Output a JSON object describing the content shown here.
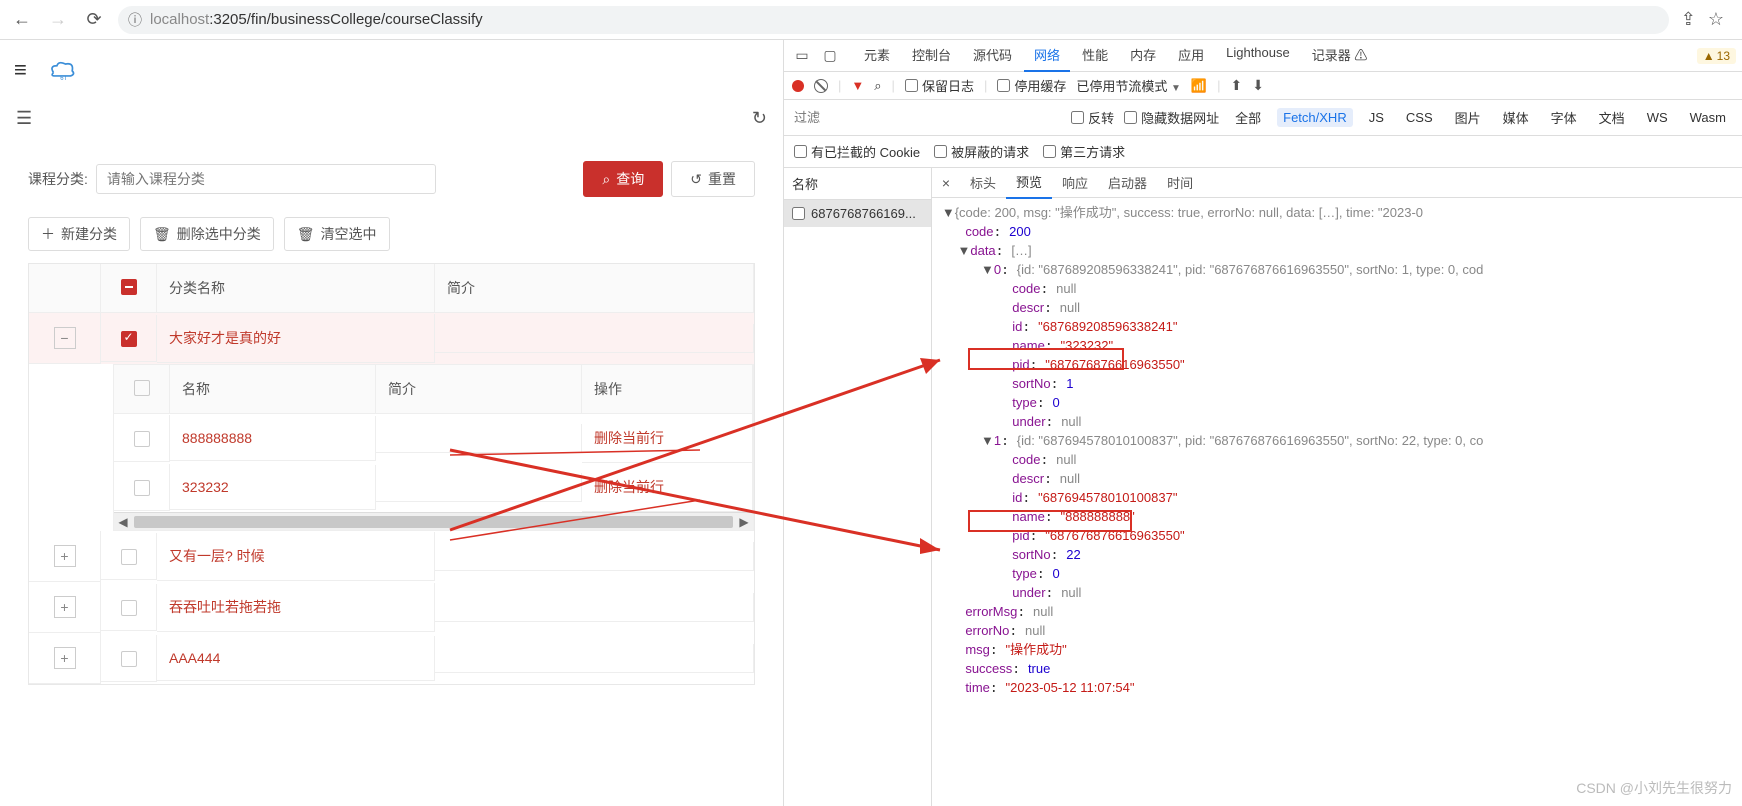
{
  "browser": {
    "url_host": "localhost",
    "url_rest": ":3205/fin/businessCollege/courseClassify"
  },
  "toolbar": {
    "filter_label": "课程分类:",
    "filter_placeholder": "请输入课程分类",
    "query_btn": "查询",
    "reset_btn": "重置",
    "new_btn": "新建分类",
    "del_sel_btn": "删除选中分类",
    "clear_sel_btn": "清空选中"
  },
  "table": {
    "headers": {
      "name": "分类名称",
      "desc": "简介"
    },
    "inner_headers": {
      "name": "名称",
      "desc": "简介",
      "action": "操作"
    },
    "row0": {
      "name": "大家好才是真的好"
    },
    "inner": [
      {
        "name": "888888888",
        "action": "删除当前行"
      },
      {
        "name": "323232",
        "action": "删除当前行"
      }
    ],
    "row1": {
      "name": "又有一层? 时候"
    },
    "row2": {
      "name": "吞吞吐吐若拖若拖"
    },
    "row3": {
      "name": "AAA444"
    }
  },
  "devtools": {
    "tabs": [
      "元素",
      "控制台",
      "源代码",
      "网络",
      "性能",
      "内存",
      "应用",
      "Lighthouse",
      "记录器"
    ],
    "warn_count": "13",
    "row2": {
      "preserve": "保留日志",
      "disable_cache": "停用缓存",
      "throttle": "已停用节流模式"
    },
    "row3": {
      "filter_ph": "过滤",
      "invert": "反转",
      "hide_data": "隐藏数据网址",
      "types": [
        "全部",
        "Fetch/XHR",
        "JS",
        "CSS",
        "图片",
        "媒体",
        "字体",
        "文档",
        "WS",
        "Wasm"
      ]
    },
    "row4": {
      "blocked": "有已拦截的 Cookie",
      "masked": "被屏蔽的请求",
      "third": "第三方请求"
    },
    "req_list_header": "名称",
    "req_item": "6876768766169...",
    "pv_tabs": [
      "标头",
      "预览",
      "响应",
      "启动器",
      "时间"
    ],
    "json_summary": "{code: 200, msg: \"操作成功\", success: true, errorNo: null, data: […], time: \"2023-0",
    "code": 200,
    "data_summary": "[…]",
    "item0_summary": "{id: \"687689208596338241\", pid: \"687676876616963550\", sortNo: 1, type: 0, cod",
    "item0": {
      "code": "null",
      "descr": "null",
      "id": "\"687689208596338241\"",
      "name": "\"323232\"",
      "pid": "\"687676876616963550\"",
      "sortNo": "1",
      "type": "0",
      "under": "null"
    },
    "item1_summary": "{id: \"687694578010100837\", pid: \"687676876616963550\", sortNo: 22, type: 0, co",
    "item1": {
      "code": "null",
      "descr": "null",
      "id": "\"687694578010100837\"",
      "name": "\"888888888\"",
      "pid": "\"687676876616963550\"",
      "sortNo": "22",
      "type": "0",
      "under": "null"
    },
    "errorMsg": "null",
    "errorNo": "null",
    "msg": "\"操作成功\"",
    "success": "true",
    "time": "\"2023-05-12 11:07:54\""
  },
  "watermark": "CSDN @小刘先生很努力"
}
